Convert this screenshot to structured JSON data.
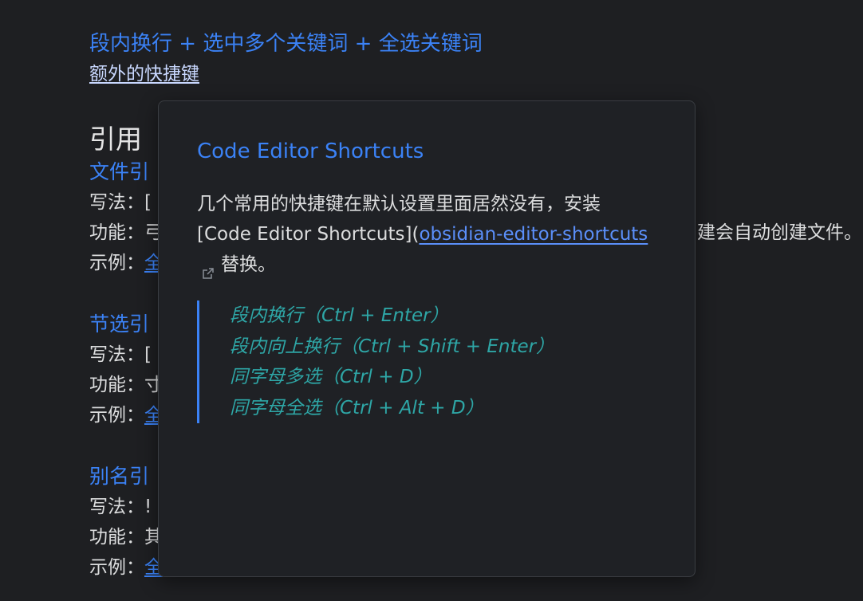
{
  "background_note": {
    "line1_parts": [
      "段内换行",
      " + ",
      "选中多个关键词",
      " + ",
      "全选关键词"
    ],
    "line2": "额外的快捷键"
  },
  "section": {
    "title": "引用",
    "items": [
      {
        "heading": "文件引",
        "rows": [
          {
            "label": "写法：",
            "value": "["
          },
          {
            "label": "功能：",
            "value": "弓",
            "tail": "建会自动创建文件。"
          },
          {
            "label": "示例：",
            "value": "全"
          }
        ]
      },
      {
        "heading": "节选引",
        "rows": [
          {
            "label": "写法：",
            "value": "["
          },
          {
            "label": "功能：",
            "value": "寸"
          },
          {
            "label": "示例：",
            "value": "全"
          }
        ]
      },
      {
        "heading": "别名引",
        "rows": [
          {
            "label": "写法：",
            "value": "!"
          },
          {
            "label": "功能：",
            "value": "其"
          },
          {
            "label": "示例：",
            "value": "全"
          }
        ]
      }
    ]
  },
  "popover": {
    "title": "Code Editor Shortcuts",
    "para_before": "几个常用的快捷键在默认设置里面居然没有，安装 [Code Editor Shortcuts](",
    "link_text": "obsidian-editor-shortcuts",
    "para_after": "替换。",
    "external_icon": "external-link-icon",
    "quote_lines": [
      "段内换行（Ctrl + Enter）",
      "段内向上换行（Ctrl + Shift + Enter）",
      "同字母多选（Ctrl + D）",
      "同字母全选（Ctrl + Alt + D）"
    ]
  },
  "colors": {
    "background": "#1e1f22",
    "accent": "#3b82f6",
    "quote_text": "#2ea6a6",
    "text": "#dcddde"
  }
}
